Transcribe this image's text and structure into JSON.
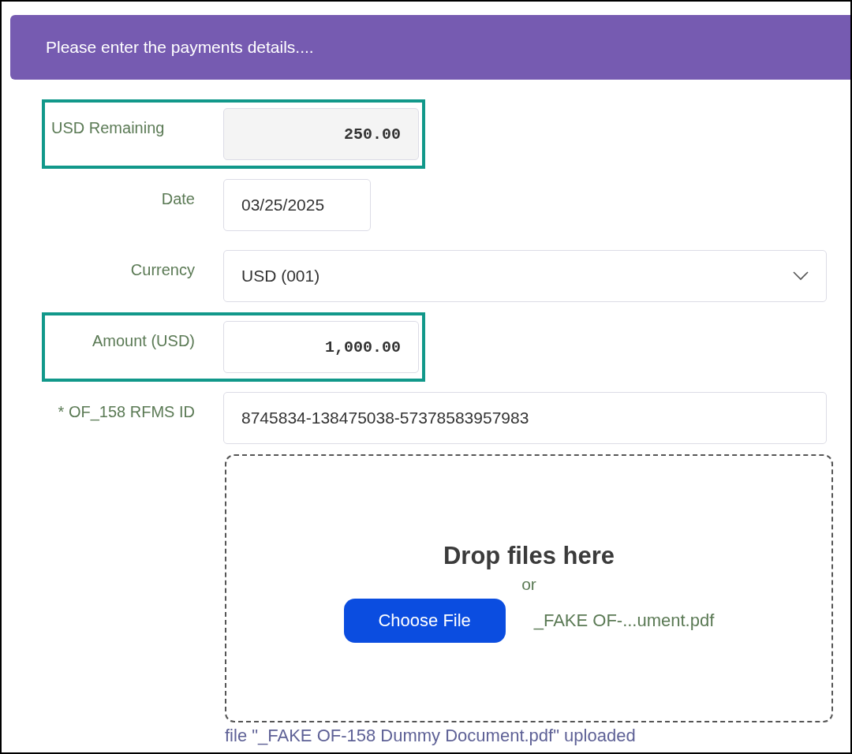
{
  "banner": {
    "text": "Please enter the payments details...."
  },
  "fields": [
    {
      "kind": "readonly",
      "label": "USD Remaining",
      "value": "250.00",
      "highlighted": true
    },
    {
      "kind": "date",
      "label": "Date",
      "value": "03/25/2025",
      "highlighted": false
    },
    {
      "kind": "select",
      "label": "Currency",
      "value": "USD (001)",
      "highlighted": false
    },
    {
      "kind": "amount",
      "label": "Amount (USD)",
      "value": "1,000.00",
      "highlighted": true
    },
    {
      "kind": "text",
      "label": "* OF_158 RFMS ID",
      "value": "8745834-138475038-57378583957983",
      "highlighted": false
    }
  ],
  "dropzone": {
    "title": "Drop files here",
    "separator": "or",
    "button": "Choose File",
    "file_name": "_FAKE OF-...ument.pdf"
  },
  "upload_status": "file \"_FAKE OF-158 Dummy Document.pdf\" uploaded"
}
